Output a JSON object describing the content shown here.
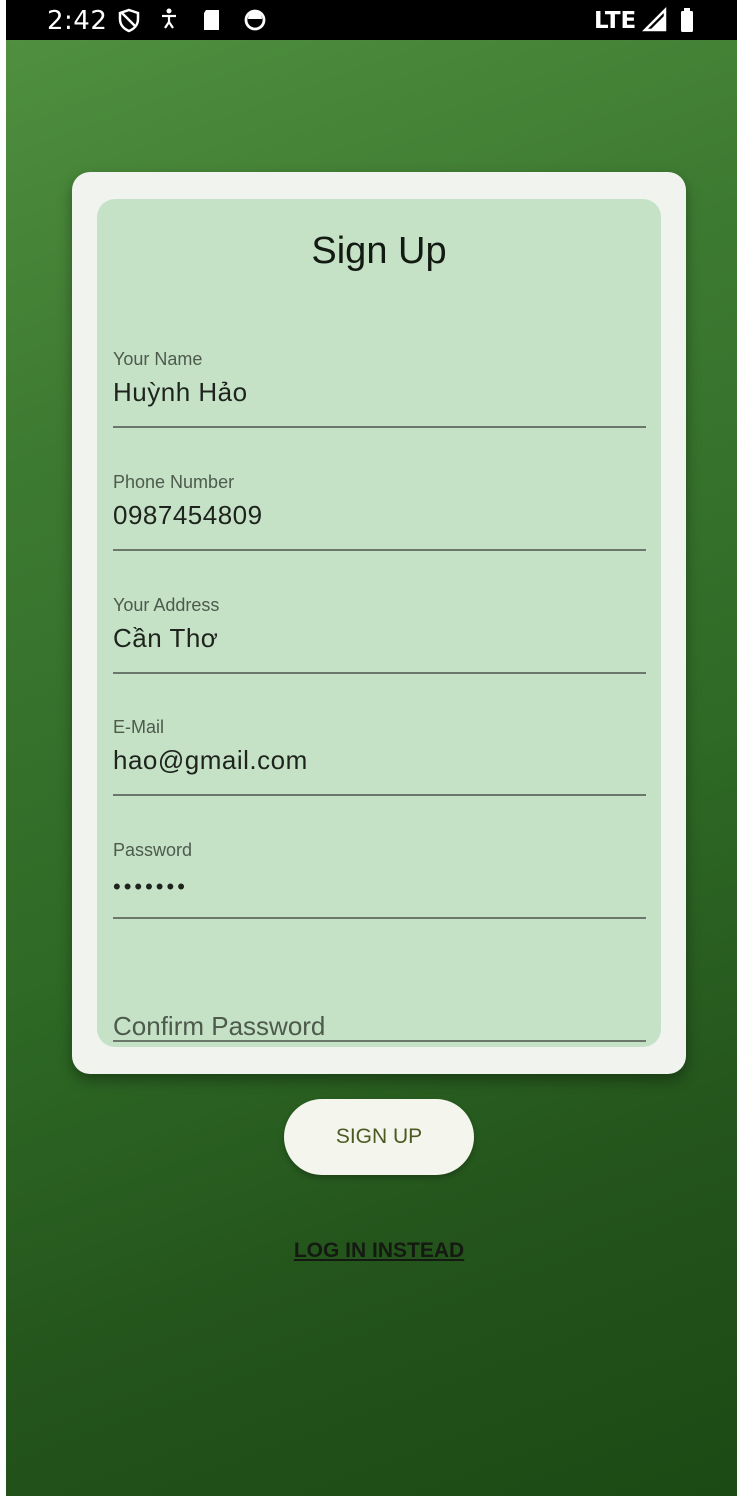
{
  "status_bar": {
    "time": "2:42",
    "network": "LTE",
    "icons": [
      "shield-icon",
      "accessibility-icon",
      "sd-card-icon",
      "circle-icon",
      "signal-icon",
      "battery-icon"
    ]
  },
  "form": {
    "title": "Sign Up",
    "fields": [
      {
        "label": "Your Name",
        "value": "Huỳnh Hảo"
      },
      {
        "label": "Phone Number",
        "value": "0987454809"
      },
      {
        "label": "Your Address",
        "value": "Cần Thơ"
      },
      {
        "label": "E-Mail",
        "value": "hao@gmail.com"
      },
      {
        "label": "Password",
        "value": "•••••••"
      },
      {
        "placeholder": "Confirm Password"
      }
    ],
    "submit_label": "SIGN UP",
    "login_label": "LOG IN INSTEAD"
  },
  "colors": {
    "background_top": "#4f8f3f",
    "background_bottom": "#1c4a14",
    "card_outer": "#f1f3ef",
    "card_inner": "#c5e2c7",
    "button_bg": "#f4f5ec",
    "button_text": "#4b5a22"
  }
}
